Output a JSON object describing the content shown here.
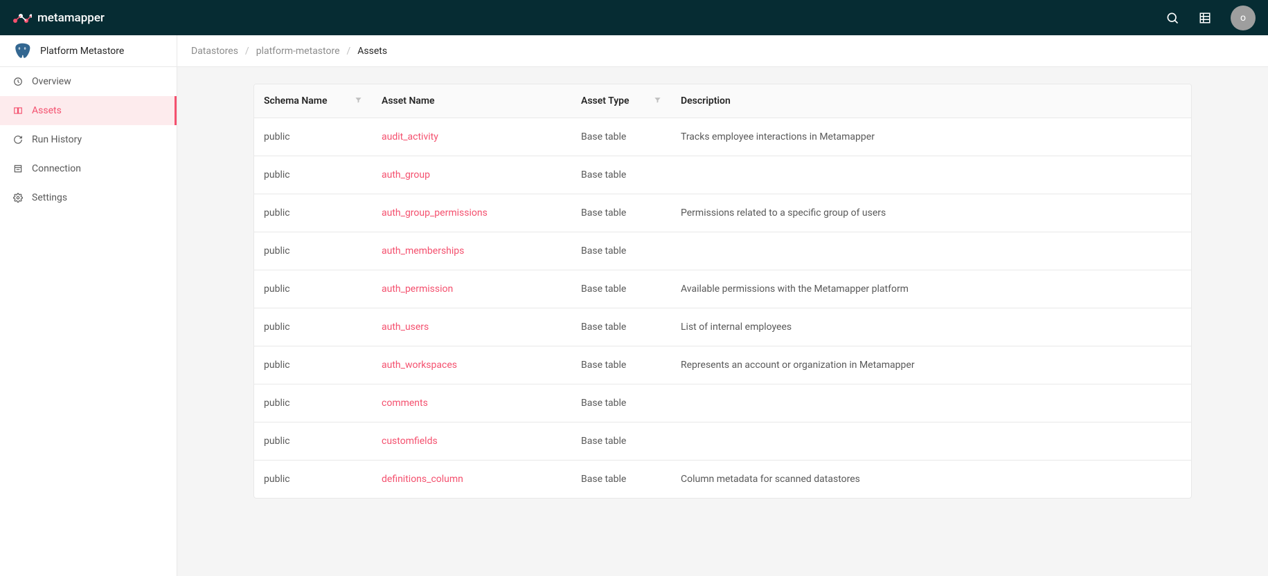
{
  "brand": "metamapper",
  "avatar_letter": "o",
  "datastore_name": "Platform Metastore",
  "sidebar": {
    "items": [
      {
        "label": "Overview",
        "icon": "dashboard-icon"
      },
      {
        "label": "Assets",
        "icon": "book-icon"
      },
      {
        "label": "Run History",
        "icon": "sync-icon"
      },
      {
        "label": "Connection",
        "icon": "profile-icon"
      },
      {
        "label": "Settings",
        "icon": "gear-icon"
      }
    ]
  },
  "breadcrumb": {
    "items": [
      "Datastores",
      "platform-metastore",
      "Assets"
    ]
  },
  "table": {
    "columns": {
      "schema": "Schema Name",
      "asset": "Asset Name",
      "type": "Asset Type",
      "description": "Description"
    },
    "rows": [
      {
        "schema": "public",
        "asset": "audit_activity",
        "type": "Base table",
        "description": "Tracks employee interactions in Metamapper"
      },
      {
        "schema": "public",
        "asset": "auth_group",
        "type": "Base table",
        "description": ""
      },
      {
        "schema": "public",
        "asset": "auth_group_permissions",
        "type": "Base table",
        "description": "Permissions related to a specific group of users"
      },
      {
        "schema": "public",
        "asset": "auth_memberships",
        "type": "Base table",
        "description": ""
      },
      {
        "schema": "public",
        "asset": "auth_permission",
        "type": "Base table",
        "description": "Available permissions with the Metamapper platform"
      },
      {
        "schema": "public",
        "asset": "auth_users",
        "type": "Base table",
        "description": "List of internal employees"
      },
      {
        "schema": "public",
        "asset": "auth_workspaces",
        "type": "Base table",
        "description": "Represents an account or organization in Metamapper"
      },
      {
        "schema": "public",
        "asset": "comments",
        "type": "Base table",
        "description": ""
      },
      {
        "schema": "public",
        "asset": "customfields",
        "type": "Base table",
        "description": ""
      },
      {
        "schema": "public",
        "asset": "definitions_column",
        "type": "Base table",
        "description": "Column metadata for scanned datastores"
      }
    ]
  }
}
